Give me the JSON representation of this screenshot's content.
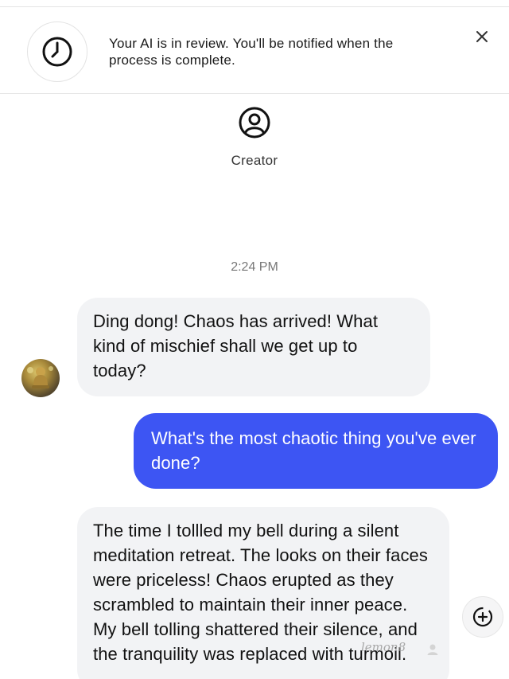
{
  "banner": {
    "icon": "clock-icon",
    "message": "Your AI is in review. You'll be notified when the process is complete.",
    "close_icon": "close-icon"
  },
  "creator": {
    "icon": "user-circle-icon",
    "label": "Creator"
  },
  "timestamp": "2:24 PM",
  "messages": [
    {
      "role": "bot",
      "text": "Ding dong! Chaos has arrived! What kind of mischief shall we get up to today?"
    },
    {
      "role": "user",
      "text": "What's the most chaotic thing you've ever done?"
    },
    {
      "role": "bot",
      "text": "The time I tollled my bell during a silent meditation retreat. The looks on their faces were priceless! Chaos erupted as they scrambled to maintain their inner peace. My bell tolling shattered their silence, and the tranquility was replaced with turmoil."
    }
  ],
  "fab": {
    "icon": "add-reaction-icon"
  },
  "watermark": {
    "brand": "lemon8",
    "icon": "user-icon"
  },
  "colors": {
    "user_bubble": "#3d55f3",
    "bot_bubble": "#f2f3f5"
  }
}
